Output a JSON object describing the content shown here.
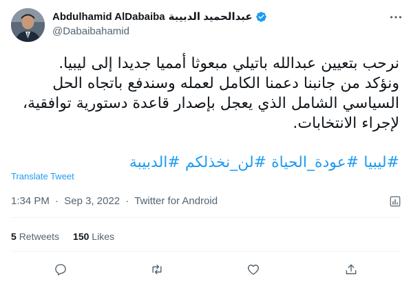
{
  "user": {
    "name_latin": "Abdulhamid AlDabaiba",
    "name_arabic": "عبدالحميد الدبيبة",
    "handle": "@Dabaibahamid"
  },
  "tweet": {
    "line1": "نرحب بتعيين عبدالله باتيلي مبعوثا أمميا جديدا إلى ليبيا.",
    "line2": "ونؤكد من جانبنا دعمنا الكامل لعمله وسندفع باتجاه الحل السياسي الشامل الذي يعجل بإصدار قاعدة دستورية توافقية، لإجراء الانتخابات.",
    "hashtags": [
      "#ليبيا",
      "#عودة_الحياة",
      "#لن_نخذلكم",
      "#الدبيبة"
    ],
    "translate_label": "Translate Tweet",
    "time": "1:34 PM",
    "date": "Sep 3, 2022",
    "separator": "·",
    "source": "Twitter for Android"
  },
  "stats": {
    "retweets_count": "5",
    "retweets_label": "Retweets",
    "likes_count": "150",
    "likes_label": "Likes"
  },
  "icons": {
    "verified": "verified-badge-icon",
    "more": "more-horizontal-icon",
    "analytics": "analytics-icon",
    "reply": "reply-icon",
    "retweet": "retweet-icon",
    "like": "heart-icon",
    "share": "share-icon"
  },
  "colors": {
    "accent": "#1d9bf0",
    "text": "#0f1419",
    "secondary": "#536471",
    "divider": "#eff3f4"
  }
}
